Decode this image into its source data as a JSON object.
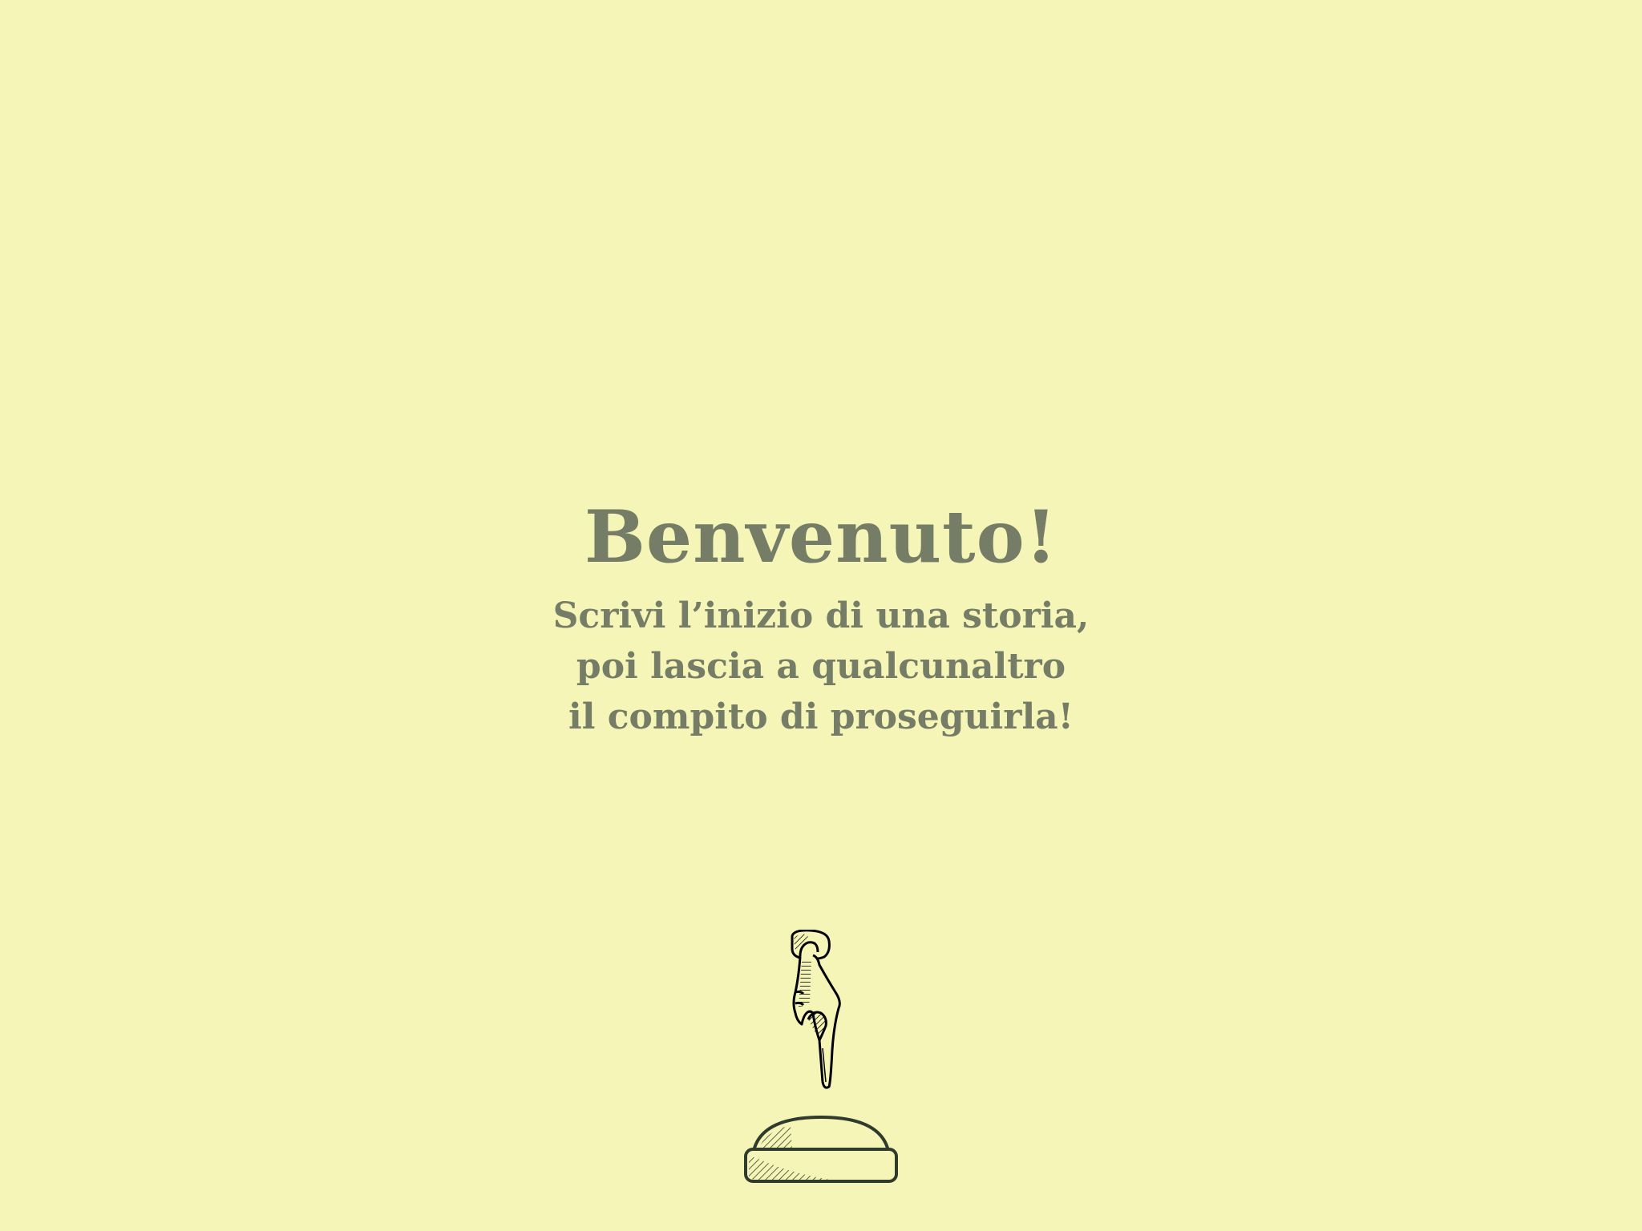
{
  "welcome": {
    "title": "Benvenuto!",
    "subtitle_lines": [
      "Scrivi l’inizio di una storia,",
      "poi lascia a qualcunaltro",
      "il compito di proseguirla!"
    ]
  },
  "icons": {
    "pointer": "pointing-hand-icon",
    "button": "push-button-icon"
  },
  "colors": {
    "background": "#f6f5b8",
    "text": "#767d66",
    "ink": "#2f3b2c"
  }
}
